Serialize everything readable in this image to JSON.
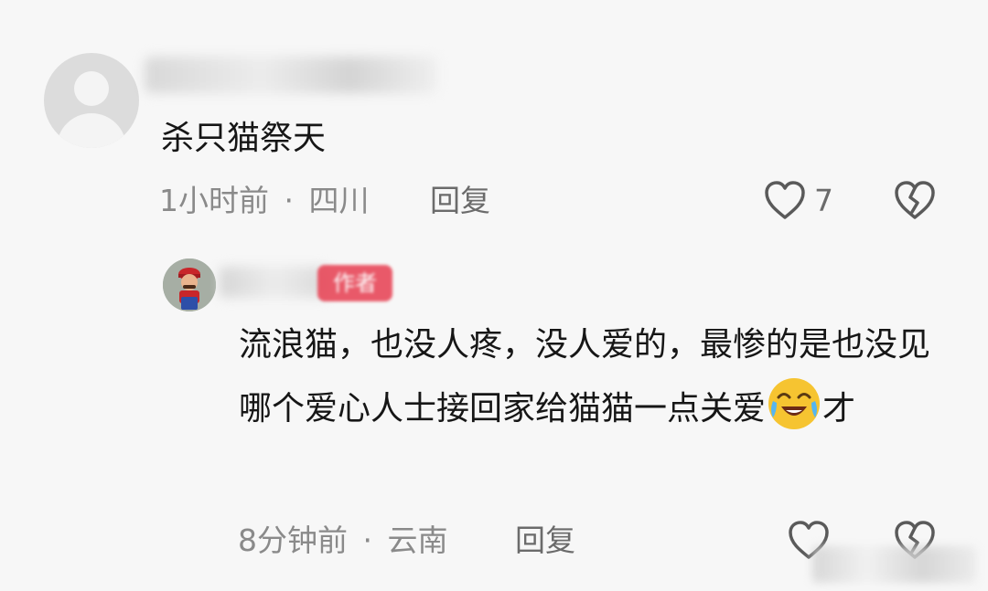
{
  "top_comment": {
    "text": "杀只猫祭天",
    "time": "1小时前",
    "separator": "·",
    "location": "四川",
    "reply_label": "回复",
    "likes": "7"
  },
  "reply_comment": {
    "author_tag": "作者",
    "text_before_emoji": "流浪猫，也没人疼，没人爱的，最惨的是也没见哪个爱心人士接回家给猫猫一点关爱",
    "emoji": "crying-laughing-emoji",
    "text_after_emoji": "才",
    "time": "8分钟前",
    "separator": "·",
    "location": "云南",
    "reply_label": "回复"
  },
  "colors": {
    "background": "#f7f7f7",
    "text": "#161616",
    "meta": "#8a8a8a",
    "tag": "#e8495a"
  }
}
